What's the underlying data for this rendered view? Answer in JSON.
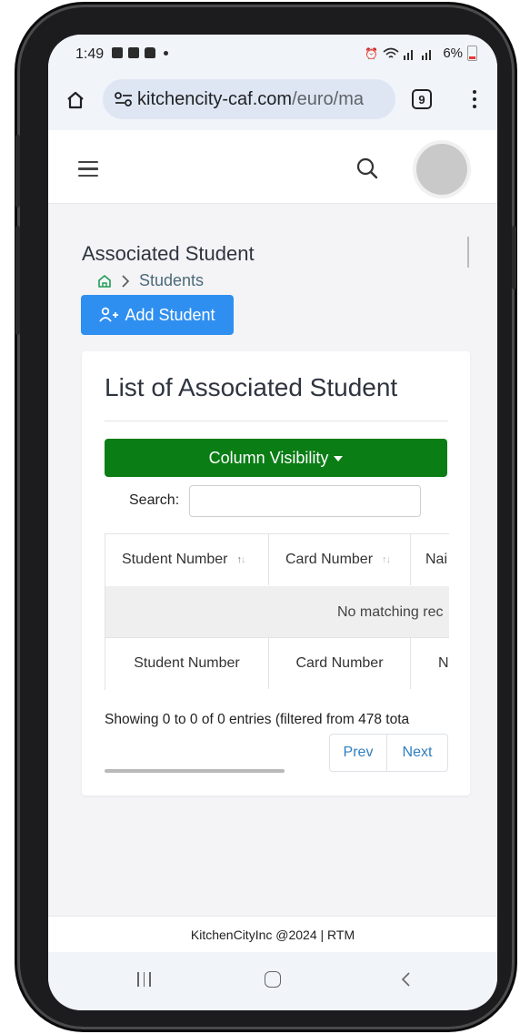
{
  "status_bar": {
    "time": "1:49",
    "battery": "6%"
  },
  "browser": {
    "url_host": "kitchencity-caf.com",
    "url_path": "/euro/ma",
    "tab_count": "9"
  },
  "page": {
    "title": "Associated Student",
    "breadcrumb": "Students",
    "add_button": "Add Student"
  },
  "card": {
    "title": "List of Associated Student",
    "column_visibility": "Column Visibility",
    "search_label": "Search:",
    "search_value": "",
    "columns": [
      "Student Number",
      "Card Number",
      "Name"
    ],
    "header_visible": [
      "Student Number",
      "Card Number",
      "Nai"
    ],
    "footer_visible": [
      "Student Number",
      "Card Number",
      "N"
    ],
    "empty_message": "No matching rec",
    "info": "Showing 0 to 0 of 0 entries (filtered from 478 tota",
    "prev": "Prev",
    "next": "Next"
  },
  "footer": {
    "text": "KitchenCityInc @2024 | RTM"
  },
  "colors": {
    "primary_button": "#2f8ff1",
    "column_visibility_button": "#0a7d15",
    "link": "#2f7fbf"
  }
}
